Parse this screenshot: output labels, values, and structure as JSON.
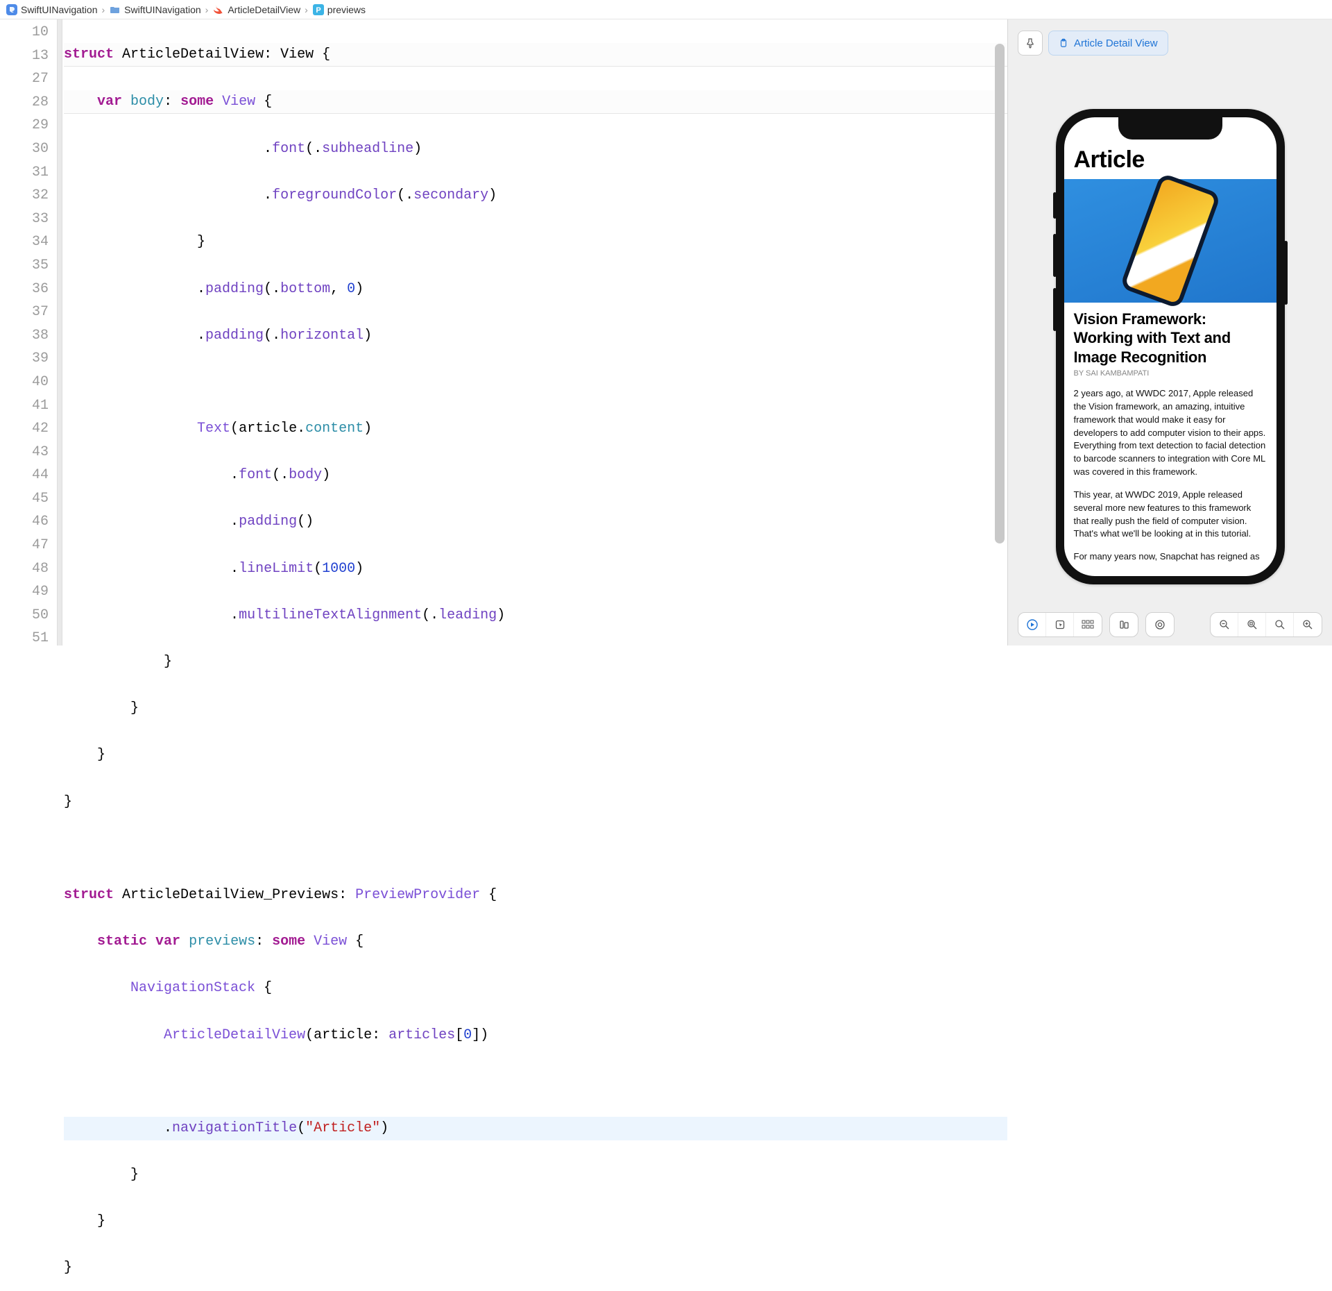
{
  "breadcrumb": {
    "project": "SwiftUINavigation",
    "folder": "SwiftUINavigation",
    "file": "ArticleDetailView",
    "symbol": "previews"
  },
  "gutter_lines": [
    "10",
    "13",
    "27",
    "28",
    "29",
    "30",
    "31",
    "32",
    "33",
    "34",
    "35",
    "36",
    "37",
    "38",
    "39",
    "40",
    "41",
    "42",
    "43",
    "44",
    "45",
    "46",
    "47",
    "48",
    "49",
    "50",
    "51"
  ],
  "code": {
    "l10": {
      "kw": "struct",
      "type": "ArticleDetailView",
      "rest": ": View {"
    },
    "l13a": {
      "kw": "var",
      "name": "body",
      "col": ":",
      "some": "some",
      "type": "View",
      "brace": " {"
    },
    "l27": {
      "pad": "                        ",
      "dot": ".",
      "fn": "font",
      "open": "(.",
      "arg": "subheadline",
      "close": ")"
    },
    "l28": {
      "pad": "                        ",
      "dot": ".",
      "fn": "foregroundColor",
      "open": "(.",
      "arg": "secondary",
      "close": ")"
    },
    "l29": "                }",
    "l30": {
      "pad": "                ",
      "dot": ".",
      "fn": "padding",
      "open": "(.",
      "arg": "bottom",
      "comma": ", ",
      "num": "0",
      "close": ")"
    },
    "l31": {
      "pad": "                ",
      "dot": ".",
      "fn": "padding",
      "open": "(.",
      "arg": "horizontal",
      "close": ")"
    },
    "l32": "",
    "l33": {
      "pad": "                ",
      "type": "Text",
      "open": "(",
      "expr": "article",
      "dot": ".",
      "prop": "content",
      "close": ")"
    },
    "l34": {
      "pad": "                    ",
      "dot": ".",
      "fn": "font",
      "open": "(.",
      "arg": "body",
      "close": ")"
    },
    "l35": {
      "pad": "                    ",
      "dot": ".",
      "fn": "padding",
      "open": "()",
      "close": ""
    },
    "l36": {
      "pad": "                    ",
      "dot": ".",
      "fn": "lineLimit",
      "open": "(",
      "num": "1000",
      "close": ")"
    },
    "l37": {
      "pad": "                    ",
      "dot": ".",
      "fn": "multilineTextAlignment",
      "open": "(.",
      "arg": "leading",
      "close": ")"
    },
    "l38": "            }",
    "l39": "        }",
    "l40": "    }",
    "l41": "}",
    "l42": "",
    "l43": {
      "kw": "struct",
      "type": "ArticleDetailView_Previews",
      "rest": ": ",
      "proto": "PreviewProvider",
      "brace": " {"
    },
    "l44": {
      "pad": "    ",
      "kw": "static",
      "kw2": "var",
      "name": "previews",
      "col": ":",
      "some": "some",
      "type": "View",
      "brace": " {"
    },
    "l45": {
      "pad": "        ",
      "type": "NavigationStack",
      "brace": " {"
    },
    "l46": {
      "pad": "            ",
      "type": "ArticleDetailView",
      "open": "(",
      "argname": "article",
      "col": ": ",
      "expr": "articles",
      "idx": "[",
      "num": "0",
      "idx2": "])"
    },
    "l47": "",
    "l48": {
      "pad": "            ",
      "dot": ".",
      "fn": "navigationTitle",
      "open": "(",
      "str": "\"Article\"",
      "close": ")"
    },
    "l49": "        }",
    "l50": "    }",
    "l51": "}"
  },
  "preview": {
    "label": "Article Detail View",
    "app_title": "Article",
    "article_title": "Vision Framework: Working with Text and Image Recognition",
    "article_author": "BY SAI KAMBAMPATI",
    "p1": "2 years ago, at WWDC 2017, Apple released the Vision framework, an amazing, intuitive framework that would make it easy for developers to add computer vision to their apps. Everything from text detection to facial detection to barcode scanners to integration with Core ML was covered in this framework.",
    "p2": "This year, at WWDC 2019, Apple released several more new features to this framework that really push the field of computer vision. That's what we'll be looking at in this tutorial.",
    "p3": "For many years now, Snapchat has reigned as"
  }
}
